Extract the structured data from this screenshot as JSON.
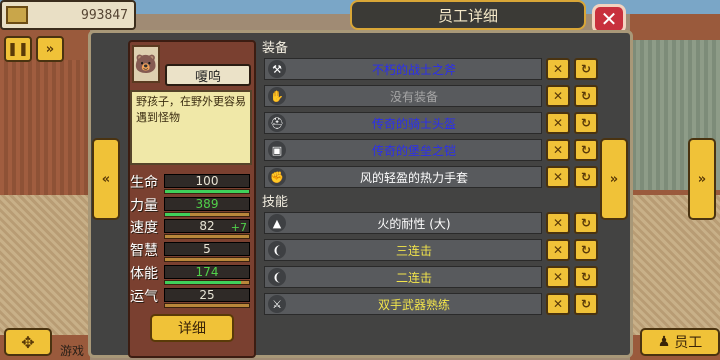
{
  "money": "993847",
  "title": "员工详细",
  "close_label": "✕",
  "employee": {
    "name": "嗄呜",
    "description": "野孩子，在野外更容易遇到怪物"
  },
  "stats": [
    {
      "label": "生命",
      "value": "100",
      "level": 1.0,
      "color": "white"
    },
    {
      "label": "力量",
      "value": "389",
      "level": 0.3,
      "color": "green"
    },
    {
      "label": "速度",
      "value": "82",
      "bonus": "+7",
      "level": 0.0,
      "color": "white"
    },
    {
      "label": "智慧",
      "value": "5",
      "level": 0.0,
      "color": "white"
    },
    {
      "label": "体能",
      "value": "174",
      "level": 0.9,
      "color": "green"
    },
    {
      "label": "运气",
      "value": "25",
      "level": 0.0,
      "color": "white"
    }
  ],
  "detail_button": "详细",
  "equipment_title": "装备",
  "equipment": [
    {
      "name": "不朽的战士之斧",
      "color": "blue",
      "icon": "axe-icon",
      "glyph": "⚒"
    },
    {
      "name": "没有装备",
      "color": "gray",
      "icon": "glove-icon",
      "glyph": "✋"
    },
    {
      "name": "传奇的骑士头盔",
      "color": "blue",
      "icon": "helmet-icon",
      "glyph": "⛑"
    },
    {
      "name": "传奇的堡垒之铠",
      "color": "blue",
      "icon": "armor-icon",
      "glyph": "▣"
    },
    {
      "name": "风的轻盈的热力手套",
      "color": "white",
      "icon": "gauntlet-icon",
      "glyph": "✊"
    }
  ],
  "skills_title": "技能",
  "skills": [
    {
      "name": "火的耐性 (大)",
      "color": "white",
      "icon": "fire-icon",
      "glyph": "▲"
    },
    {
      "name": "三连击",
      "color": "yellow",
      "icon": "slash-icon",
      "glyph": "❨"
    },
    {
      "name": "二连击",
      "color": "yellow",
      "icon": "slash-icon",
      "glyph": "❨"
    },
    {
      "name": "双手武器熟练",
      "color": "yellow",
      "icon": "sword-icon",
      "glyph": "⚔"
    }
  ],
  "game_text": "游戏",
  "staff_button": "员工"
}
